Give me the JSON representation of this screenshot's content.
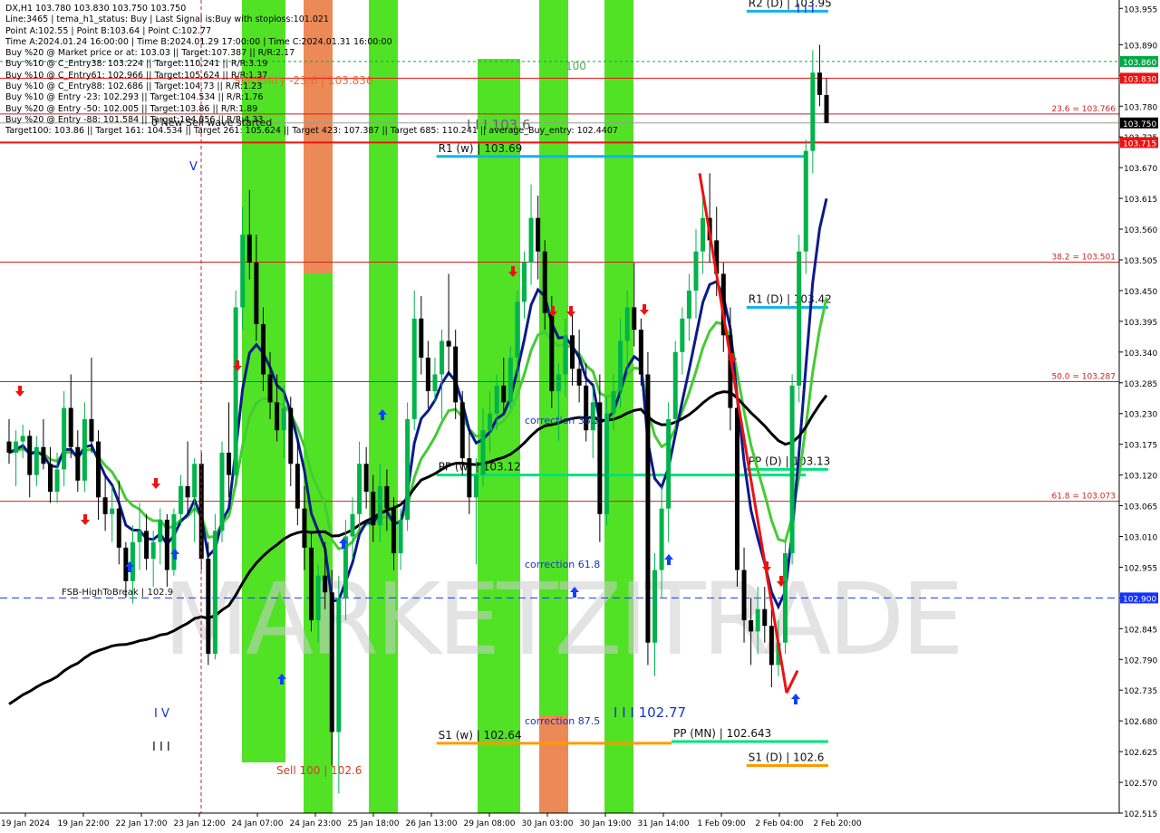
{
  "header": {
    "symbol_line": "DX,H1  103.780 103.830 103.750 103.750",
    "info_lines": [
      "Line:3465 | tema_h1_status: Buy | Last Signal is:Buy with stoploss:101.021",
      "Point A:102.55 | Point B:103.64 | Point C:102.77",
      "Time A:2024.01.24 16:00:00 | Time B:2024.01.29 17:00:00 | Time C:2024.01.31 16:00:00",
      "Buy %20 @ Market price or at: 103.03 || Target:107.387 || R/R:2.17",
      "Buy %10 @ C_Entry38: 103.224 || Target:110.241 || R/R:3.19",
      "Buy %10 @ C_Entry61: 102.966 || Target:105.624 || R/R:1.37",
      "Buy %10 @ C_Entry88: 102.686 || Target:104.73 || R/R:1.23",
      "Buy %10 @ Entry -23: 102.293 || Target:104.534 || R/R:1.76",
      "Buy %20 @ Entry -50: 102.005 || Target:103.86 || R/R:1.89",
      "Buy %20 @ Entry -88: 101.584 || Target:104.856 || R/R:4.33",
      "Target100: 103.86 || Target 161: 104.534 || Target 261: 105.624 || Target 423: 107.387 || Target 685: 110.241 || average_Buy_entry: 102.4407"
    ]
  },
  "watermark": "MARKETZITRADE",
  "colors": {
    "bg": "#ffffff",
    "bull": "#00b34a",
    "bear": "#000000",
    "green_band": "#33dd00",
    "orange_band": "#e8763a",
    "resistance": "#e00000",
    "level_cyan": "#12b3ea",
    "level_green": "#00e27a",
    "level_orange": "#ff9900",
    "ma_navy": "#0a1a8a",
    "ma_green": "#44cc33",
    "ma_black": "#000000",
    "blue_arrow": "#1040ff",
    "red_arrow": "#ee1111"
  },
  "chart_data": {
    "type": "candlestick",
    "symbol": "DX",
    "timeframe": "H1",
    "ylim": [
      102.515,
      103.97
    ],
    "x_tick_labels": [
      "19 Jan 2024",
      "19 Jan 22:00",
      "22 Jan 17:00",
      "23 Jan 12:00",
      "24 Jan 07:00",
      "24 Jan 23:00",
      "25 Jan 18:00",
      "26 Jan 13:00",
      "29 Jan 08:00",
      "30 Jan 03:00",
      "30 Jan 19:00",
      "31 Jan 14:00",
      "1 Feb 09:00",
      "2 Feb 04:00",
      "2 Feb 20:00"
    ],
    "y_tick_labels": [
      "103.955",
      "103.890",
      "103.835",
      "103.780",
      "103.725",
      "103.670",
      "103.615",
      "103.560",
      "103.505",
      "103.450",
      "103.395",
      "103.340",
      "103.285",
      "103.230",
      "103.175",
      "103.120",
      "103.065",
      "103.010",
      "102.955",
      "102.900",
      "102.845",
      "102.790",
      "102.735",
      "102.680",
      "102.625",
      "102.570",
      "102.515"
    ],
    "price_badges": [
      {
        "label": "103.860",
        "value": 103.86,
        "bg": "#00aa44",
        "fg": "#ffffff"
      },
      {
        "label": "103.830",
        "value": 103.83,
        "bg": "#ee1111",
        "fg": "#ffffff"
      },
      {
        "label": "103.750",
        "value": 103.75,
        "bg": "#000000",
        "fg": "#ffffff"
      },
      {
        "label": "103.715",
        "value": 103.715,
        "bg": "#ee1111",
        "fg": "#ffffff"
      },
      {
        "label": "102.900",
        "value": 102.9,
        "bg": "#1533ff",
        "fg": "#ffffff"
      }
    ],
    "fib_levels": [
      {
        "label": "23.6 = 103.766",
        "value": 103.766
      },
      {
        "label": "38.2 = 103.501",
        "value": 103.501
      },
      {
        "label": "50.0 = 103.287",
        "value": 103.287
      },
      {
        "label": "61.8 = 103.073",
        "value": 103.073
      }
    ],
    "pivot_levels": [
      {
        "label": "R1 (w) | 103.69",
        "value": 103.69,
        "x_from": 0.39,
        "x_to": 0.72,
        "color": "#12b3ea"
      },
      {
        "label": "PP (w) | 103.12",
        "value": 103.12,
        "x_from": 0.39,
        "x_to": 0.72,
        "color": "#00e27a"
      },
      {
        "label": "S1 (w) | 102.64",
        "value": 102.64,
        "x_from": 0.39,
        "x_to": 0.6,
        "color": "#ff9900"
      },
      {
        "label": "PP (MN) | 102.643",
        "value": 102.643,
        "x_from": 0.6,
        "x_to": 0.74,
        "color": "#00e27a"
      },
      {
        "label": "R1 (D) | 103.42",
        "value": 103.42,
        "x_from": 0.667,
        "x_to": 0.74,
        "color": "#12b3ea"
      },
      {
        "label": "PP (D) | 103.13",
        "value": 103.13,
        "x_from": 0.667,
        "x_to": 0.74,
        "color": "#00e27a"
      },
      {
        "label": "S1 (D) | 102.6",
        "value": 102.6,
        "x_from": 0.667,
        "x_to": 0.74,
        "color": "#ff9900"
      },
      {
        "label": "R2 (D) | 103.95",
        "value": 103.95,
        "x_from": 0.667,
        "x_to": 0.74,
        "color": "#12b3ea"
      }
    ],
    "labels": {
      "sell_entry": "Sell Entry -23.6 | 103.836",
      "new_sell_wave": "0 New Sell wave started",
      "iii_1036": "I I I 103.6",
      "fsb_high": "FSB-HighToBreak | 102.9",
      "sell100": "Sell 100 | 102.6",
      "correction382": "correction 38.2",
      "correction618": "correction 61.8",
      "correction875": "correction 87.5",
      "iii_10277": "I I I 102.77",
      "v_label": "V",
      "iv_label": "I V",
      "iii_small": "I I I",
      "hundred": "100"
    },
    "candles": [
      [
        103.18,
        103.22,
        103.14,
        103.16
      ],
      [
        103.16,
        103.2,
        103.1,
        103.18
      ],
      [
        103.18,
        103.21,
        103.15,
        103.19
      ],
      [
        103.19,
        103.2,
        103.08,
        103.12
      ],
      [
        103.12,
        103.19,
        103.1,
        103.17
      ],
      [
        103.17,
        103.22,
        103.13,
        103.14
      ],
      [
        103.14,
        103.17,
        103.07,
        103.09
      ],
      [
        103.09,
        103.16,
        103.07,
        103.13
      ],
      [
        103.13,
        103.27,
        103.1,
        103.24
      ],
      [
        103.24,
        103.3,
        103.15,
        103.17
      ],
      [
        103.17,
        103.2,
        103.09,
        103.11
      ],
      [
        103.11,
        103.25,
        103.09,
        103.22
      ],
      [
        103.22,
        103.33,
        103.16,
        103.18
      ],
      [
        103.18,
        103.2,
        103.04,
        103.08
      ],
      [
        103.08,
        103.12,
        103.02,
        103.05
      ],
      [
        103.05,
        103.1,
        103.0,
        103.06
      ],
      [
        103.06,
        103.11,
        102.96,
        102.99
      ],
      [
        102.99,
        103.0,
        102.9,
        102.93
      ],
      [
        102.93,
        103.03,
        102.89,
        103.0
      ],
      [
        103.0,
        103.07,
        102.95,
        103.02
      ],
      [
        103.02,
        103.05,
        102.95,
        102.97
      ],
      [
        102.97,
        103.02,
        102.92,
        103.0
      ],
      [
        103.0,
        103.06,
        102.96,
        103.04
      ],
      [
        103.04,
        103.05,
        102.92,
        102.95
      ],
      [
        102.95,
        103.06,
        102.94,
        103.05
      ],
      [
        103.05,
        103.12,
        103.03,
        103.1
      ],
      [
        103.1,
        103.18,
        103.05,
        103.08
      ],
      [
        103.08,
        103.15,
        103.0,
        103.14
      ],
      [
        103.14,
        103.16,
        102.95,
        102.97
      ],
      [
        102.97,
        103.0,
        102.78,
        102.8
      ],
      [
        102.8,
        103.05,
        102.79,
        103.02
      ],
      [
        103.02,
        103.18,
        103.0,
        103.16
      ],
      [
        103.16,
        103.25,
        103.08,
        103.12
      ],
      [
        103.12,
        103.45,
        103.1,
        103.42
      ],
      [
        103.42,
        103.6,
        103.38,
        103.55
      ],
      [
        103.55,
        103.63,
        103.47,
        103.5
      ],
      [
        103.5,
        103.55,
        103.36,
        103.39
      ],
      [
        103.39,
        103.42,
        103.27,
        103.3
      ],
      [
        103.3,
        103.34,
        103.22,
        103.25
      ],
      [
        103.25,
        103.3,
        103.18,
        103.2
      ],
      [
        103.2,
        103.28,
        103.15,
        103.24
      ],
      [
        103.24,
        103.26,
        103.1,
        103.14
      ],
      [
        103.14,
        103.18,
        103.03,
        103.06
      ],
      [
        103.06,
        103.1,
        102.95,
        102.99
      ],
      [
        102.99,
        103.02,
        102.84,
        102.86
      ],
      [
        102.86,
        102.96,
        102.82,
        102.94
      ],
      [
        102.94,
        103.0,
        102.88,
        102.91
      ],
      [
        102.91,
        102.95,
        102.6,
        102.66
      ],
      [
        102.66,
        102.94,
        102.55,
        102.9
      ],
      [
        102.9,
        103.04,
        102.86,
        103.01
      ],
      [
        103.01,
        103.08,
        102.97,
        103.05
      ],
      [
        103.05,
        103.18,
        103.02,
        103.14
      ],
      [
        103.14,
        103.17,
        103.06,
        103.09
      ],
      [
        103.09,
        103.12,
        103.0,
        103.03
      ],
      [
        103.03,
        103.14,
        103.0,
        103.1
      ],
      [
        103.1,
        103.13,
        103.02,
        103.06
      ],
      [
        103.06,
        103.08,
        102.95,
        102.98
      ],
      [
        102.98,
        103.06,
        102.95,
        103.04
      ],
      [
        103.04,
        103.25,
        103.02,
        103.22
      ],
      [
        103.22,
        103.45,
        103.2,
        103.4
      ],
      [
        103.4,
        103.44,
        103.3,
        103.33
      ],
      [
        103.33,
        103.36,
        103.24,
        103.27
      ],
      [
        103.27,
        103.33,
        103.25,
        103.3
      ],
      [
        103.3,
        103.38,
        103.22,
        103.36
      ],
      [
        103.36,
        103.48,
        103.3,
        103.35
      ],
      [
        103.35,
        103.38,
        103.22,
        103.25
      ],
      [
        103.25,
        103.27,
        103.12,
        103.15
      ],
      [
        103.15,
        103.2,
        103.05,
        103.08
      ],
      [
        103.08,
        103.15,
        102.96,
        103.12
      ],
      [
        103.12,
        103.24,
        103.1,
        103.2
      ],
      [
        103.2,
        103.27,
        103.16,
        103.23
      ],
      [
        103.23,
        103.3,
        103.2,
        103.28
      ],
      [
        103.28,
        103.33,
        103.23,
        103.25
      ],
      [
        103.25,
        103.35,
        103.24,
        103.33
      ],
      [
        103.33,
        103.45,
        103.3,
        103.43
      ],
      [
        103.43,
        103.52,
        103.4,
        103.5
      ],
      [
        103.5,
        103.64,
        103.46,
        103.58
      ],
      [
        103.58,
        103.62,
        103.47,
        103.52
      ],
      [
        103.52,
        103.54,
        103.38,
        103.41
      ],
      [
        103.41,
        103.44,
        103.24,
        103.27
      ],
      [
        103.27,
        103.32,
        103.18,
        103.3
      ],
      [
        103.3,
        103.4,
        103.26,
        103.37
      ],
      [
        103.37,
        103.41,
        103.28,
        103.31
      ],
      [
        103.31,
        103.38,
        103.25,
        103.28
      ],
      [
        103.28,
        103.32,
        103.18,
        103.2
      ],
      [
        103.2,
        103.28,
        103.15,
        103.25
      ],
      [
        103.25,
        103.3,
        103.0,
        103.05
      ],
      [
        103.05,
        103.26,
        103.03,
        103.23
      ],
      [
        103.23,
        103.3,
        103.2,
        103.27
      ],
      [
        103.27,
        103.4,
        103.24,
        103.36
      ],
      [
        103.36,
        103.45,
        103.3,
        103.42
      ],
      [
        103.42,
        103.5,
        103.35,
        103.38
      ],
      [
        103.38,
        103.4,
        103.28,
        103.3
      ],
      [
        103.3,
        103.34,
        102.78,
        102.82
      ],
      [
        102.82,
        102.98,
        102.76,
        102.95
      ],
      [
        102.95,
        103.1,
        102.9,
        103.06
      ],
      [
        103.06,
        103.25,
        103.0,
        103.22
      ],
      [
        103.22,
        103.36,
        103.2,
        103.34
      ],
      [
        103.34,
        103.42,
        103.3,
        103.4
      ],
      [
        103.4,
        103.48,
        103.36,
        103.45
      ],
      [
        103.45,
        103.56,
        103.4,
        103.52
      ],
      [
        103.52,
        103.62,
        103.48,
        103.58
      ],
      [
        103.58,
        103.66,
        103.5,
        103.54
      ],
      [
        103.54,
        103.6,
        103.44,
        103.48
      ],
      [
        103.48,
        103.5,
        103.34,
        103.37
      ],
      [
        103.37,
        103.42,
        103.2,
        103.24
      ],
      [
        103.24,
        103.27,
        102.92,
        102.95
      ],
      [
        102.95,
        102.99,
        102.82,
        102.86
      ],
      [
        102.86,
        102.9,
        102.78,
        102.84
      ],
      [
        102.84,
        102.92,
        102.8,
        102.88
      ],
      [
        102.88,
        102.92,
        102.82,
        102.85
      ],
      [
        102.85,
        102.88,
        102.74,
        102.78
      ],
      [
        102.78,
        102.86,
        102.76,
        102.82
      ],
      [
        102.82,
        103.0,
        102.8,
        102.98
      ],
      [
        102.98,
        103.3,
        102.96,
        103.28
      ],
      [
        103.28,
        103.55,
        103.25,
        103.52
      ],
      [
        103.52,
        103.72,
        103.48,
        103.7
      ],
      [
        103.7,
        103.88,
        103.66,
        103.84
      ],
      [
        103.84,
        103.89,
        103.78,
        103.8
      ],
      [
        103.8,
        103.83,
        103.75,
        103.75
      ]
    ]
  }
}
